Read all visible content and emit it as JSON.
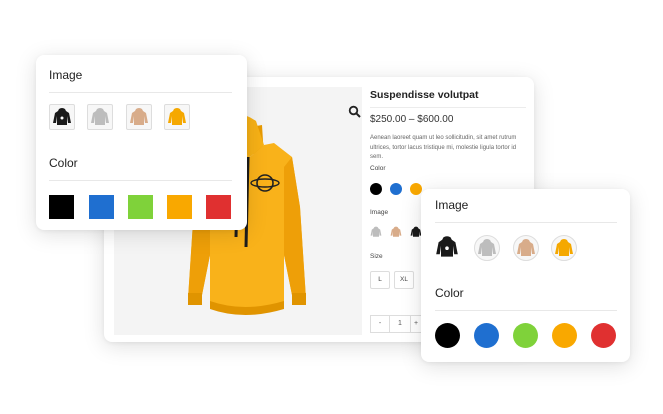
{
  "product": {
    "title": "Suspendisse volutpat",
    "price": "$250.00 – $600.00",
    "description": "Aenean laoreet quam ut leo sollicitudin, sit amet rutrum ultrices, tortor lacus tristique mi, molestie ligula tortor id sem.",
    "color_label": "Color",
    "image_label": "Image",
    "size_label": "Size",
    "sizes": [
      "L",
      "XL"
    ],
    "quantity": {
      "minus": "-",
      "value": "1",
      "plus": "+"
    },
    "zoom_icon": "search-icon",
    "colors": [
      "#000000",
      "#1f6fd0",
      "#f9a800"
    ]
  },
  "panel_square": {
    "image_title": "Image",
    "color_title": "Color",
    "colors": [
      "#000000",
      "#1f6fd0",
      "#7fd23a",
      "#f9a800",
      "#e03030"
    ]
  },
  "panel_round": {
    "image_title": "Image",
    "color_title": "Color",
    "colors": [
      "#000000",
      "#1f6fd0",
      "#7fd23a",
      "#f9a800",
      "#e03030"
    ]
  },
  "thumbnail_icons": [
    "black-hoodie-icon",
    "grey-hoodie-icon",
    "beige-hoodie-icon",
    "yellow-hoodie-icon"
  ]
}
